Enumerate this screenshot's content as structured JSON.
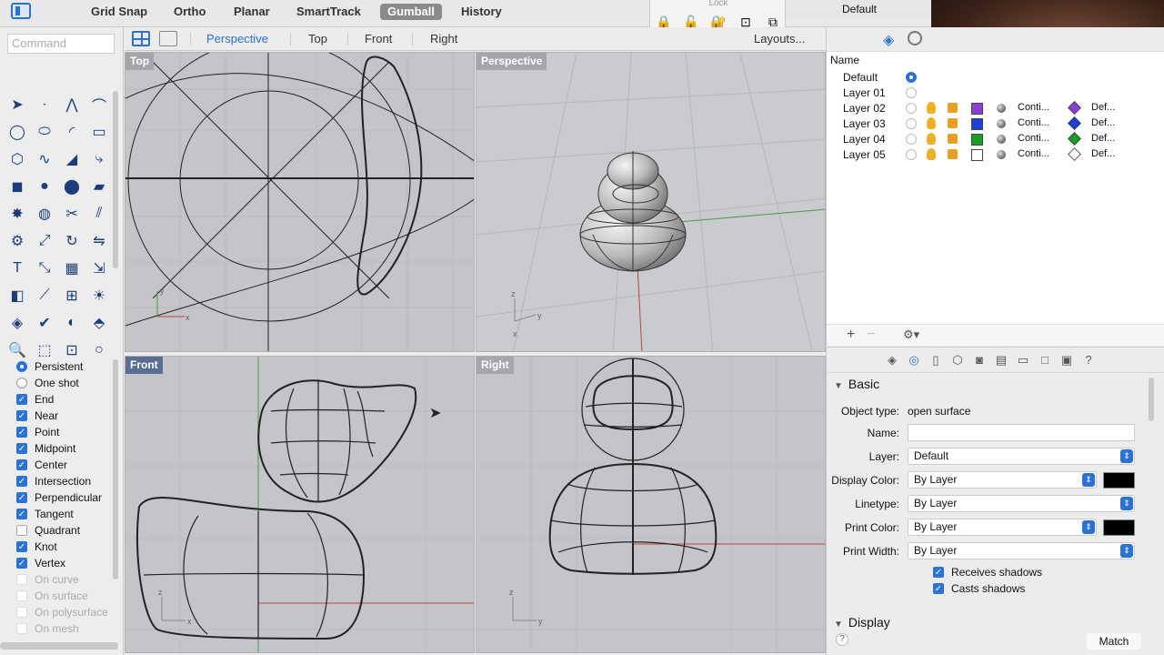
{
  "topbar": {
    "modes": [
      "Grid Snap",
      "Ortho",
      "Planar",
      "SmartTrack",
      "Gumball",
      "History"
    ],
    "active_mode": "Gumball",
    "lock_label": "Lock",
    "layer_display": "Default"
  },
  "command": {
    "placeholder": "Command"
  },
  "tools": [
    "select-arrow-icon",
    "point-icon",
    "polyline-icon",
    "curve-icon",
    "circle-icon",
    "ellipse-icon",
    "arc-icon",
    "rectangle-icon",
    "polygon-icon",
    "freeform-curve-icon",
    "surface-icon",
    "edit-curve-icon",
    "box-icon",
    "sphere-icon",
    "cylinder-icon",
    "extrude-icon",
    "explode-icon",
    "boolean-icon",
    "trim-icon",
    "split-icon",
    "gear-icon",
    "transform-icon",
    "rotate-icon",
    "mirror-icon",
    "text-icon",
    "scale-icon",
    "array-icon",
    "dimension-icon",
    "solid-box-icon",
    "line-tool-icon",
    "grid-icon",
    "lights-icon",
    "surface-analysis-icon",
    "check-icon",
    "render-icon",
    "paint-icon",
    "zoom-icon",
    "zoom-window-icon",
    "zoom-extents-icon",
    "search-icon"
  ],
  "tool_glyphs": [
    "➤",
    "·",
    "⋀",
    "⌒",
    "◯",
    "⬭",
    "◜",
    "▭",
    "⬡",
    "∿",
    "◢",
    "⤷",
    "◼",
    "●",
    "⬤",
    "▰",
    "✸",
    "◍",
    "✂",
    "⫽",
    "⚙",
    "⤢",
    "↻",
    "⇋",
    "T",
    "⤡",
    "▦",
    "⇲",
    "◧",
    "⟋",
    "⊞",
    "☀",
    "◈",
    "✔",
    "◐",
    "⬘",
    "🔍",
    "⬚",
    "⊡",
    "○"
  ],
  "osnap": {
    "persistent_label": "Persistent",
    "oneshot_label": "One shot",
    "items": [
      {
        "label": "End",
        "checked": true,
        "enabled": true
      },
      {
        "label": "Near",
        "checked": true,
        "enabled": true
      },
      {
        "label": "Point",
        "checked": true,
        "enabled": true
      },
      {
        "label": "Midpoint",
        "checked": true,
        "enabled": true
      },
      {
        "label": "Center",
        "checked": true,
        "enabled": true
      },
      {
        "label": "Intersection",
        "checked": true,
        "enabled": true
      },
      {
        "label": "Perpendicular",
        "checked": true,
        "enabled": true
      },
      {
        "label": "Tangent",
        "checked": true,
        "enabled": true
      },
      {
        "label": "Quadrant",
        "checked": false,
        "enabled": true
      },
      {
        "label": "Knot",
        "checked": true,
        "enabled": true
      },
      {
        "label": "Vertex",
        "checked": true,
        "enabled": true
      },
      {
        "label": "On curve",
        "checked": false,
        "enabled": false
      },
      {
        "label": "On surface",
        "checked": false,
        "enabled": false
      },
      {
        "label": "On polysurface",
        "checked": false,
        "enabled": false
      },
      {
        "label": "On mesh",
        "checked": false,
        "enabled": false
      }
    ]
  },
  "viewport_tabs": {
    "tabs": [
      "Perspective",
      "Top",
      "Front",
      "Right"
    ],
    "active": "Perspective",
    "layouts_label": "Layouts..."
  },
  "viewports": {
    "top": {
      "label": "Top",
      "axis_x": "x",
      "axis_y": "y"
    },
    "perspective": {
      "label": "Perspective",
      "axis_x": "x",
      "axis_y": "y",
      "axis_z": "z"
    },
    "front": {
      "label": "Front",
      "axis_x": "x",
      "axis_z": "z"
    },
    "right": {
      "label": "Right",
      "axis_y": "y",
      "axis_z": "z"
    }
  },
  "layers": {
    "header": "Name",
    "rows": [
      {
        "name": "Default",
        "current": true,
        "color": "",
        "linetype": "",
        "print_width": ""
      },
      {
        "name": "Layer 01",
        "current": false,
        "color": "",
        "linetype": "",
        "print_width": ""
      },
      {
        "name": "Layer 02",
        "current": false,
        "color": "#8b3fd6",
        "linetype": "Conti...",
        "print_width": "Def..."
      },
      {
        "name": "Layer 03",
        "current": false,
        "color": "#1a3fe0",
        "linetype": "Conti...",
        "print_width": "Def..."
      },
      {
        "name": "Layer 04",
        "current": false,
        "color": "#14a020",
        "linetype": "Conti...",
        "print_width": "Def..."
      },
      {
        "name": "Layer 05",
        "current": false,
        "color": "#ffffff",
        "linetype": "Conti...",
        "print_width": "Def..."
      }
    ]
  },
  "properties": {
    "section_basic": "Basic",
    "object_type_label": "Object type:",
    "object_type_value": "open surface",
    "name_label": "Name:",
    "name_value": "",
    "layer_label": "Layer:",
    "layer_value": "Default",
    "display_color_label": "Display Color:",
    "display_color_value": "By Layer",
    "linetype_label": "Linetype:",
    "linetype_value": "By Layer",
    "print_color_label": "Print Color:",
    "print_color_value": "By Layer",
    "print_width_label": "Print Width:",
    "print_width_value": "By Layer",
    "receives_shadows_label": "Receives shadows",
    "casts_shadows_label": "Casts shadows",
    "section_display": "Display",
    "match_label": "Match",
    "help_label": "?"
  },
  "colors": {
    "accent": "#2a72d8",
    "viewport_bg": "#c3c5c9",
    "active_label": "#5a6e94"
  }
}
